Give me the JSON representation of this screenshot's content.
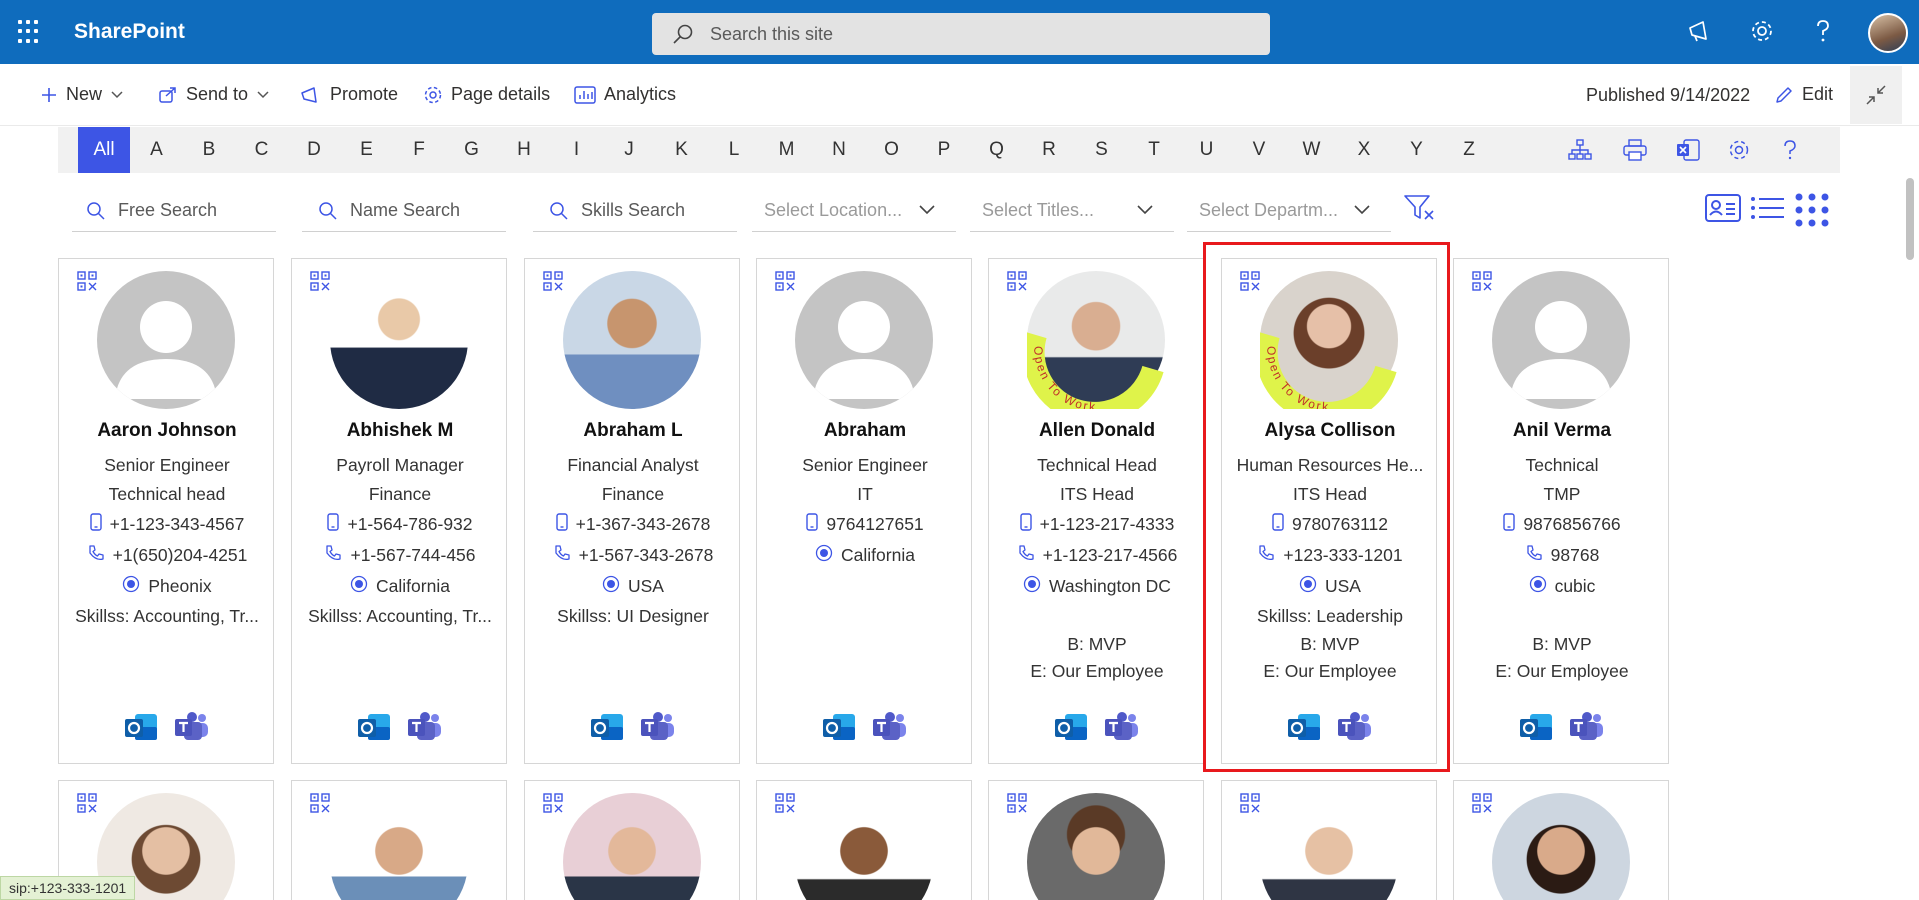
{
  "app": {
    "brand": "SharePoint",
    "search_placeholder": "Search this site"
  },
  "commands": {
    "new": "New",
    "send_to": "Send to",
    "promote": "Promote",
    "page_details": "Page details",
    "analytics": "Analytics",
    "published": "Published 9/14/2022",
    "edit": "Edit"
  },
  "alphabet": [
    "All",
    "A",
    "B",
    "C",
    "D",
    "E",
    "F",
    "G",
    "H",
    "I",
    "J",
    "K",
    "L",
    "M",
    "N",
    "O",
    "P",
    "Q",
    "R",
    "S",
    "T",
    "U",
    "V",
    "W",
    "X",
    "Y",
    "Z"
  ],
  "filters": {
    "free_search": "Free Search",
    "name_search": "Name Search",
    "skills_search": "Skills Search",
    "location": "Select Location...",
    "titles": "Select Titles...",
    "department": "Select Departm..."
  },
  "people": [
    {
      "name": "Aaron Johnson",
      "title": "Senior Engineer",
      "dept": "Technical head",
      "mobile": "+1-123-343-4567",
      "phone": "+1(650)204-4251",
      "location": "Pheonix",
      "skills": "Skillss: Accounting, Tr...",
      "badge": "",
      "employee": "",
      "photo": "default",
      "open_to_work": false
    },
    {
      "name": "Abhishek M",
      "title": "Payroll Manager",
      "dept": "Finance",
      "mobile": "+1-564-786-932",
      "phone": "+1-567-744-456",
      "location": "California",
      "skills": "Skillss: Accounting, Tr...",
      "badge": "",
      "employee": "",
      "photo": "p1",
      "open_to_work": false
    },
    {
      "name": "Abraham L",
      "title": "Financial Analyst",
      "dept": "Finance",
      "mobile": "+1-367-343-2678",
      "phone": "+1-567-343-2678",
      "location": "USA",
      "skills": "Skillss: UI Designer",
      "badge": "",
      "employee": "",
      "photo": "p2",
      "open_to_work": false
    },
    {
      "name": "Abraham",
      "title": "Senior Engineer",
      "dept": "IT",
      "mobile": "9764127651",
      "phone": "",
      "location": "California",
      "skills": "",
      "badge": "",
      "employee": "",
      "photo": "default",
      "open_to_work": false
    },
    {
      "name": "Allen Donald",
      "title": "Technical Head",
      "dept": "ITS Head",
      "mobile": "+1-123-217-4333",
      "phone": "+1-123-217-4566",
      "location": "Washington DC",
      "skills": "",
      "badge": "B: MVP",
      "employee": "E: Our Employee",
      "photo": "p3",
      "open_to_work": true
    },
    {
      "name": "Alysa Collison",
      "title": "Human Resources He...",
      "dept": "ITS Head",
      "mobile": "9780763112",
      "phone": "+123-333-1201",
      "location": "USA",
      "skills": "Skillss: Leadership",
      "badge": "B: MVP",
      "employee": "E: Our Employee",
      "photo": "p4",
      "open_to_work": true
    },
    {
      "name": "Anil Verma",
      "title": "Technical",
      "dept": "TMP",
      "mobile": "9876856766",
      "phone": "98768",
      "location": "cubic",
      "skills": "",
      "badge": "B: MVP",
      "employee": "E: Our Employee",
      "photo": "default",
      "open_to_work": false
    }
  ],
  "open_to_work_label": "Open To Work",
  "status_link": "sip:+123-333-1201",
  "colors": {
    "suitebar": "#0f6cbd",
    "accent": "#3d55e5",
    "highlight": "#e8191d",
    "open_to_work": "#dff34a"
  }
}
